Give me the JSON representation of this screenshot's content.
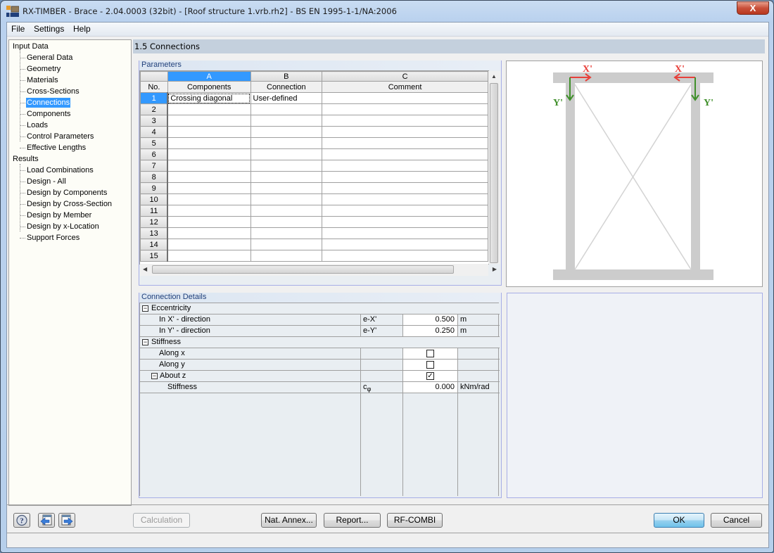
{
  "window": {
    "title": "RX-TIMBER - Brace - 2.04.0003 (32bit) - [Roof structure 1.vrb.rh2] - BS EN 1995-1-1/NA:2006",
    "close_label": "X"
  },
  "menu": [
    "File",
    "Settings",
    "Help"
  ],
  "nav": {
    "input_label": "Input Data",
    "input_items": [
      "General Data",
      "Geometry",
      "Materials",
      "Cross-Sections",
      "Connections",
      "Components",
      "Loads",
      "Control Parameters",
      "Effective Lengths"
    ],
    "results_label": "Results",
    "results_items": [
      "Load Combinations",
      "Design - All",
      "Design by Components",
      "Design by Cross-Section",
      "Design by Member",
      "Design by x-Location",
      "Support Forces"
    ],
    "selected": "Connections"
  },
  "content": {
    "title": "1.5 Connections"
  },
  "parameters": {
    "label": "Parameters",
    "col_letters": [
      "A",
      "B",
      "C"
    ],
    "no_header": "No.",
    "columns": [
      "Components",
      "Connection",
      "Comment"
    ],
    "rows": [
      {
        "no": "1",
        "components": "Crossing diagonal",
        "connection": "User-defined",
        "comment": ""
      },
      {
        "no": "2",
        "components": "",
        "connection": "",
        "comment": ""
      },
      {
        "no": "3",
        "components": "",
        "connection": "",
        "comment": ""
      },
      {
        "no": "4",
        "components": "",
        "connection": "",
        "comment": ""
      },
      {
        "no": "5",
        "components": "",
        "connection": "",
        "comment": ""
      },
      {
        "no": "6",
        "components": "",
        "connection": "",
        "comment": ""
      },
      {
        "no": "7",
        "components": "",
        "connection": "",
        "comment": ""
      },
      {
        "no": "8",
        "components": "",
        "connection": "",
        "comment": ""
      },
      {
        "no": "9",
        "components": "",
        "connection": "",
        "comment": ""
      },
      {
        "no": "10",
        "components": "",
        "connection": "",
        "comment": ""
      },
      {
        "no": "11",
        "components": "",
        "connection": "",
        "comment": ""
      },
      {
        "no": "12",
        "components": "",
        "connection": "",
        "comment": ""
      },
      {
        "no": "13",
        "components": "",
        "connection": "",
        "comment": ""
      },
      {
        "no": "14",
        "components": "",
        "connection": "",
        "comment": ""
      },
      {
        "no": "15",
        "components": "",
        "connection": "",
        "comment": ""
      }
    ]
  },
  "details": {
    "label": "Connection Details",
    "eccentricity": {
      "label": "Eccentricity",
      "x": {
        "label": "In X' - direction",
        "symbol": "e-X'",
        "value": "0.500",
        "unit": "m"
      },
      "y": {
        "label": "In Y' - direction",
        "symbol": "e-Y'",
        "value": "0.250",
        "unit": "m"
      }
    },
    "stiffness": {
      "label": "Stiffness",
      "along_x": {
        "label": "Along x",
        "checked": false
      },
      "along_y": {
        "label": "Along y",
        "checked": false
      },
      "about_z": {
        "label": "About z",
        "checked": true,
        "check_mark": "✓"
      },
      "stiffness_row": {
        "label": "Stiffness",
        "symbol": "c",
        "symbol_sub": "φ",
        "value": "0.000",
        "unit": "kNm/rad"
      }
    }
  },
  "diagram": {
    "x_label": "X'",
    "y_label": "Y'",
    "x_color": "#e8403a",
    "y_color": "#3f8f2a",
    "member_color": "#cccccc"
  },
  "buttons": {
    "calculation": "Calculation",
    "nat_annex": "Nat. Annex...",
    "report": "Report...",
    "rf_combi": "RF-COMBI",
    "ok": "OK",
    "cancel": "Cancel"
  },
  "colors": {
    "selection": "#3399ff"
  }
}
